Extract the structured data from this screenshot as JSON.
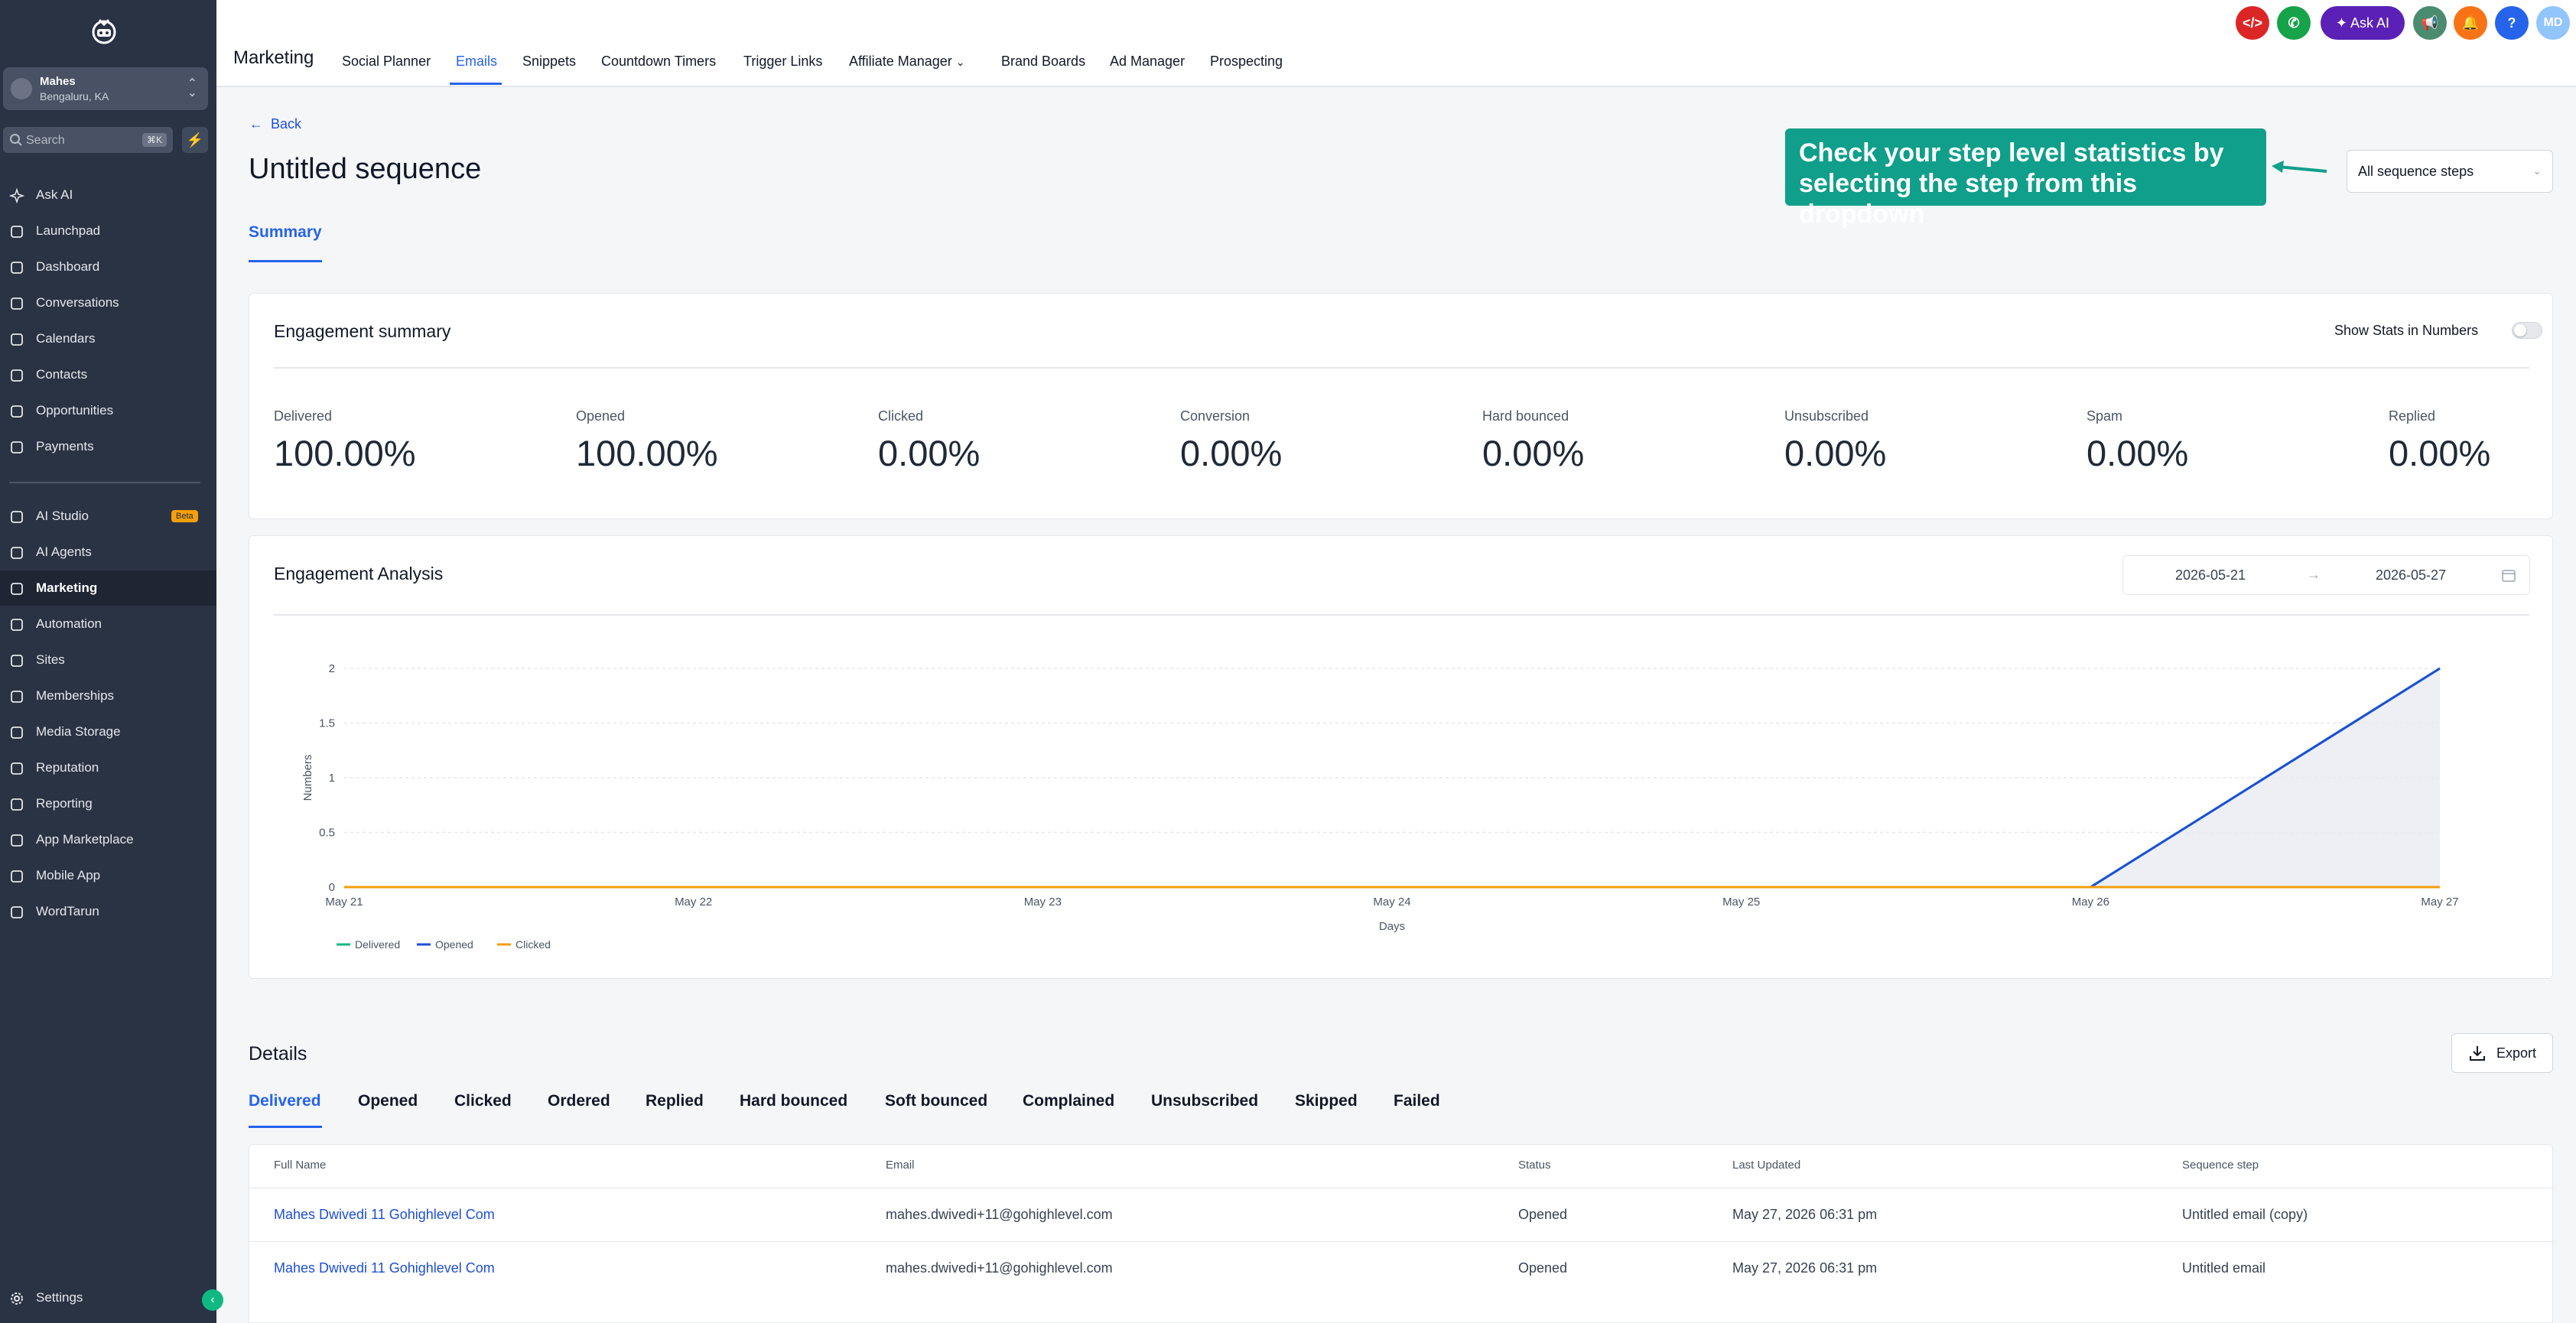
{
  "sidebar": {
    "account": {
      "name": "Mahes",
      "location": "Bengaluru, KA"
    },
    "search": {
      "placeholder": "Search",
      "shortcut": "⌘K"
    },
    "items": [
      {
        "label": "Ask AI",
        "icon": "sparkle-icon"
      },
      {
        "label": "Launchpad",
        "icon": "rocket-icon"
      },
      {
        "label": "Dashboard",
        "icon": "dashboard-icon"
      },
      {
        "label": "Conversations",
        "icon": "chat-icon"
      },
      {
        "label": "Calendars",
        "icon": "calendar-icon"
      },
      {
        "label": "Contacts",
        "icon": "contacts-icon"
      },
      {
        "label": "Opportunities",
        "icon": "opportunities-icon"
      },
      {
        "label": "Payments",
        "icon": "payments-icon"
      },
      {
        "label": "AI Studio",
        "icon": "ai-studio-icon",
        "badge": "Beta"
      },
      {
        "label": "AI Agents",
        "icon": "ai-agents-icon"
      },
      {
        "label": "Marketing",
        "icon": "send-icon",
        "active": true
      },
      {
        "label": "Automation",
        "icon": "automation-icon"
      },
      {
        "label": "Sites",
        "icon": "sites-icon"
      },
      {
        "label": "Memberships",
        "icon": "memberships-icon"
      },
      {
        "label": "Media Storage",
        "icon": "media-icon"
      },
      {
        "label": "Reputation",
        "icon": "star-icon"
      },
      {
        "label": "Reporting",
        "icon": "reporting-icon"
      },
      {
        "label": "App Marketplace",
        "icon": "marketplace-icon"
      },
      {
        "label": "Mobile App",
        "icon": "mobile-icon"
      },
      {
        "label": "WordTarun",
        "icon": "wordpress-icon"
      }
    ],
    "settings_label": "Settings"
  },
  "topbar": {
    "title": "Marketing",
    "nav": [
      "Social Planner",
      "Emails",
      "Snippets",
      "Countdown Timers",
      "Trigger Links",
      "Affiliate Manager",
      "Brand Boards",
      "Ad Manager",
      "Prospecting"
    ],
    "active_nav": "Emails",
    "ask_ai_label": "Ask AI",
    "avatar_initials": "MD",
    "help_label": "?"
  },
  "page": {
    "back_label": "Back",
    "title": "Untitled sequence",
    "tip_text": "Check your step level statistics by selecting the step from this dropdown",
    "step_select_value": "All sequence steps",
    "tab_label": "Summary"
  },
  "engagement_summary": {
    "title": "Engagement summary",
    "toggle_label": "Show Stats in Numbers",
    "stats": [
      {
        "label": "Delivered",
        "value": "100.00%"
      },
      {
        "label": "Opened",
        "value": "100.00%"
      },
      {
        "label": "Clicked",
        "value": "0.00%"
      },
      {
        "label": "Conversion",
        "value": "0.00%"
      },
      {
        "label": "Hard bounced",
        "value": "0.00%"
      },
      {
        "label": "Unsubscribed",
        "value": "0.00%"
      },
      {
        "label": "Spam",
        "value": "0.00%"
      },
      {
        "label": "Replied",
        "value": "0.00%"
      }
    ]
  },
  "engagement_analysis": {
    "title": "Engagement Analysis",
    "date_from": "2026-05-21",
    "date_to": "2026-05-27",
    "date_arrow": "→"
  },
  "chart_data": {
    "type": "line",
    "xlabel": "Days",
    "ylabel": "Numbers",
    "categories": [
      "May 21",
      "May 22",
      "May 23",
      "May 24",
      "May 25",
      "May 26",
      "May 27"
    ],
    "yticks": [
      "0",
      "0.5",
      "1",
      "1.5",
      "2"
    ],
    "ylim": [
      0,
      2
    ],
    "grid": true,
    "legend_position": "bottom-left",
    "series": [
      {
        "name": "Delivered",
        "color": "#10b981",
        "values": [
          0,
          0,
          0,
          0,
          0,
          0,
          2
        ]
      },
      {
        "name": "Opened",
        "color": "#1d4ed8",
        "values": [
          0,
          0,
          0,
          0,
          0,
          0,
          2
        ]
      },
      {
        "name": "Clicked",
        "color": "#f59e0b",
        "values": [
          0,
          0,
          0,
          0,
          0,
          0,
          0
        ]
      }
    ]
  },
  "details": {
    "title": "Details",
    "export_label": "Export",
    "tabs": [
      "Delivered",
      "Opened",
      "Clicked",
      "Ordered",
      "Replied",
      "Hard bounced",
      "Soft bounced",
      "Complained",
      "Unsubscribed",
      "Skipped",
      "Failed"
    ],
    "active_tab": "Delivered",
    "columns": [
      "Full Name",
      "Email",
      "Status",
      "Last Updated",
      "Sequence step"
    ],
    "rows": [
      [
        "Mahes Dwivedi 11 Gohighlevel Com",
        "mahes.dwivedi+11@gohighlevel.com",
        "Opened",
        "May 27, 2026 06:31 pm",
        "Untitled email (copy)"
      ],
      [
        "Mahes Dwivedi 11 Gohighlevel Com",
        "mahes.dwivedi+11@gohighlevel.com",
        "Opened",
        "May 27, 2026 06:31 pm",
        "Untitled email"
      ]
    ]
  },
  "colors": {
    "sidebar_bg": "#2a3344",
    "accent": "#2563eb",
    "tip_bg": "#0f9f8a"
  }
}
